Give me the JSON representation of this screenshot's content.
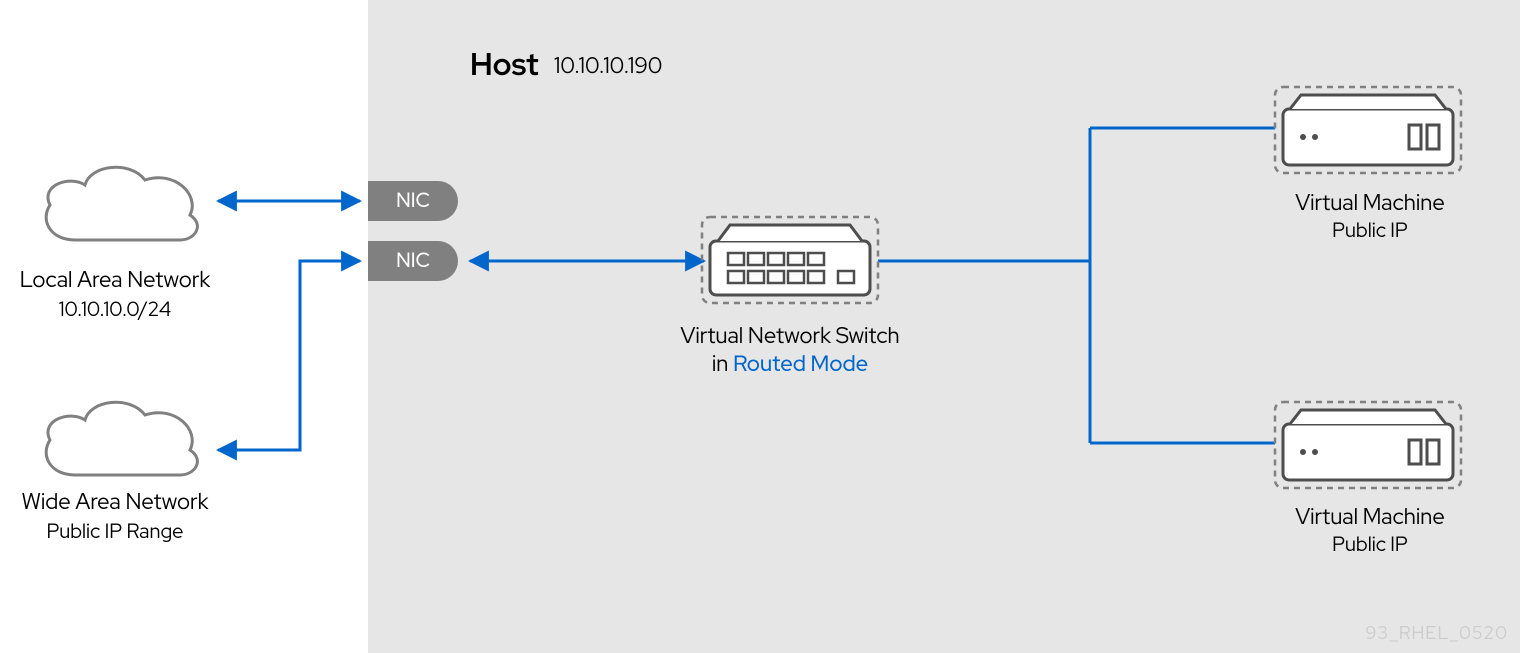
{
  "host": {
    "title": "Host",
    "ip": "10.10.10.190"
  },
  "lan": {
    "title": "Local Area Network",
    "subnet": "10.10.10.0/24"
  },
  "wan": {
    "title": "Wide Area Network",
    "range": "Public IP Range"
  },
  "nic1_label": "NIC",
  "nic2_label": "NIC",
  "switch": {
    "line1": "Virtual Network Switch",
    "line2_prefix": "in ",
    "line2_accent": "Routed Mode"
  },
  "vm1": {
    "title": "Virtual Machine",
    "ip": "Public IP"
  },
  "vm2": {
    "title": "Virtual Machine",
    "ip": "Public IP"
  },
  "watermark": "93_RHEL_0520"
}
